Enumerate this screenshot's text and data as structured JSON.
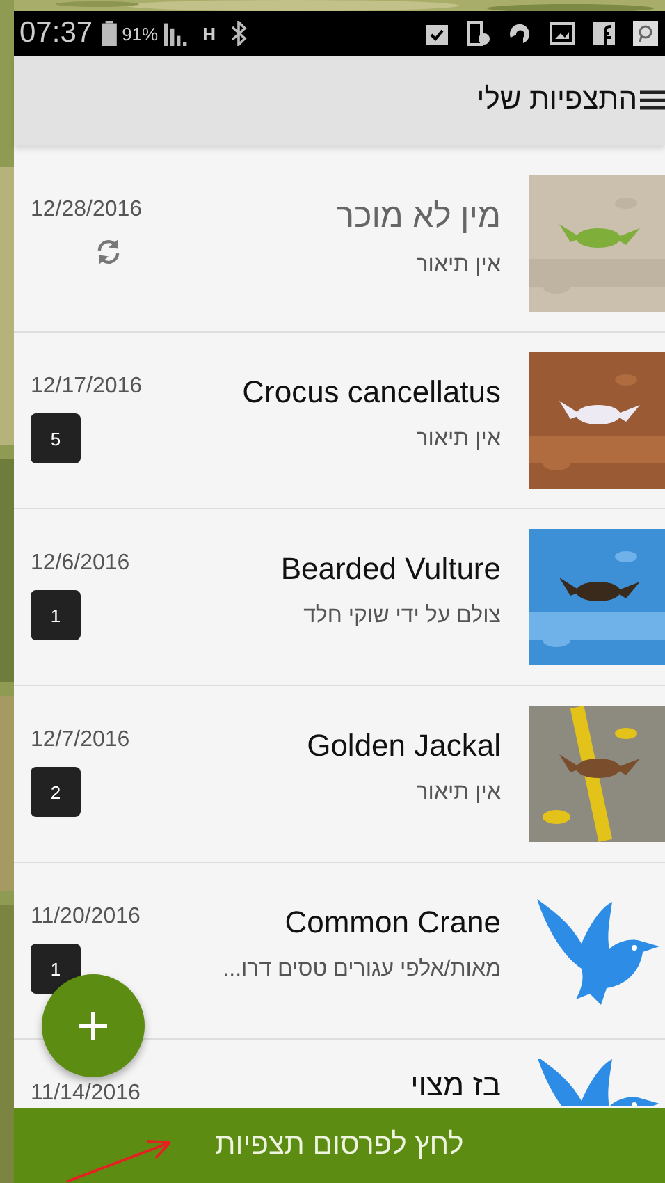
{
  "status_bar": {
    "time": "07:37",
    "battery": "91%",
    "network": "H"
  },
  "header": {
    "title": "התצפיות שלי"
  },
  "observations": [
    {
      "title": "מין לא מוכר",
      "identified": false,
      "description": "אין תיאור",
      "date": "12/28/2016",
      "pending_sync": true
    },
    {
      "title": "Crocus cancellatus",
      "identified": true,
      "description": "אין תיאור",
      "date": "12/17/2016",
      "pending_sync": false,
      "count": "5"
    },
    {
      "title": "Bearded Vulture",
      "identified": true,
      "description": "צולם על ידי שוקי חלד",
      "date": "12/6/2016",
      "pending_sync": false,
      "count": "1"
    },
    {
      "title": "Golden Jackal",
      "identified": true,
      "description": "אין תיאור",
      "date": "12/7/2016",
      "pending_sync": false,
      "count": "2"
    },
    {
      "title": "Common Crane",
      "identified": true,
      "description": "מאות/אלפי  עגורים טסים דרו...",
      "date": "11/20/2016",
      "pending_sync": false,
      "count": "1",
      "kind": "bird"
    },
    {
      "title": "בז מצוי",
      "identified": true,
      "date": "11/14/2016",
      "kind": "bird"
    }
  ],
  "publish_button": {
    "label": "לחץ לפרסום תצפיות"
  }
}
